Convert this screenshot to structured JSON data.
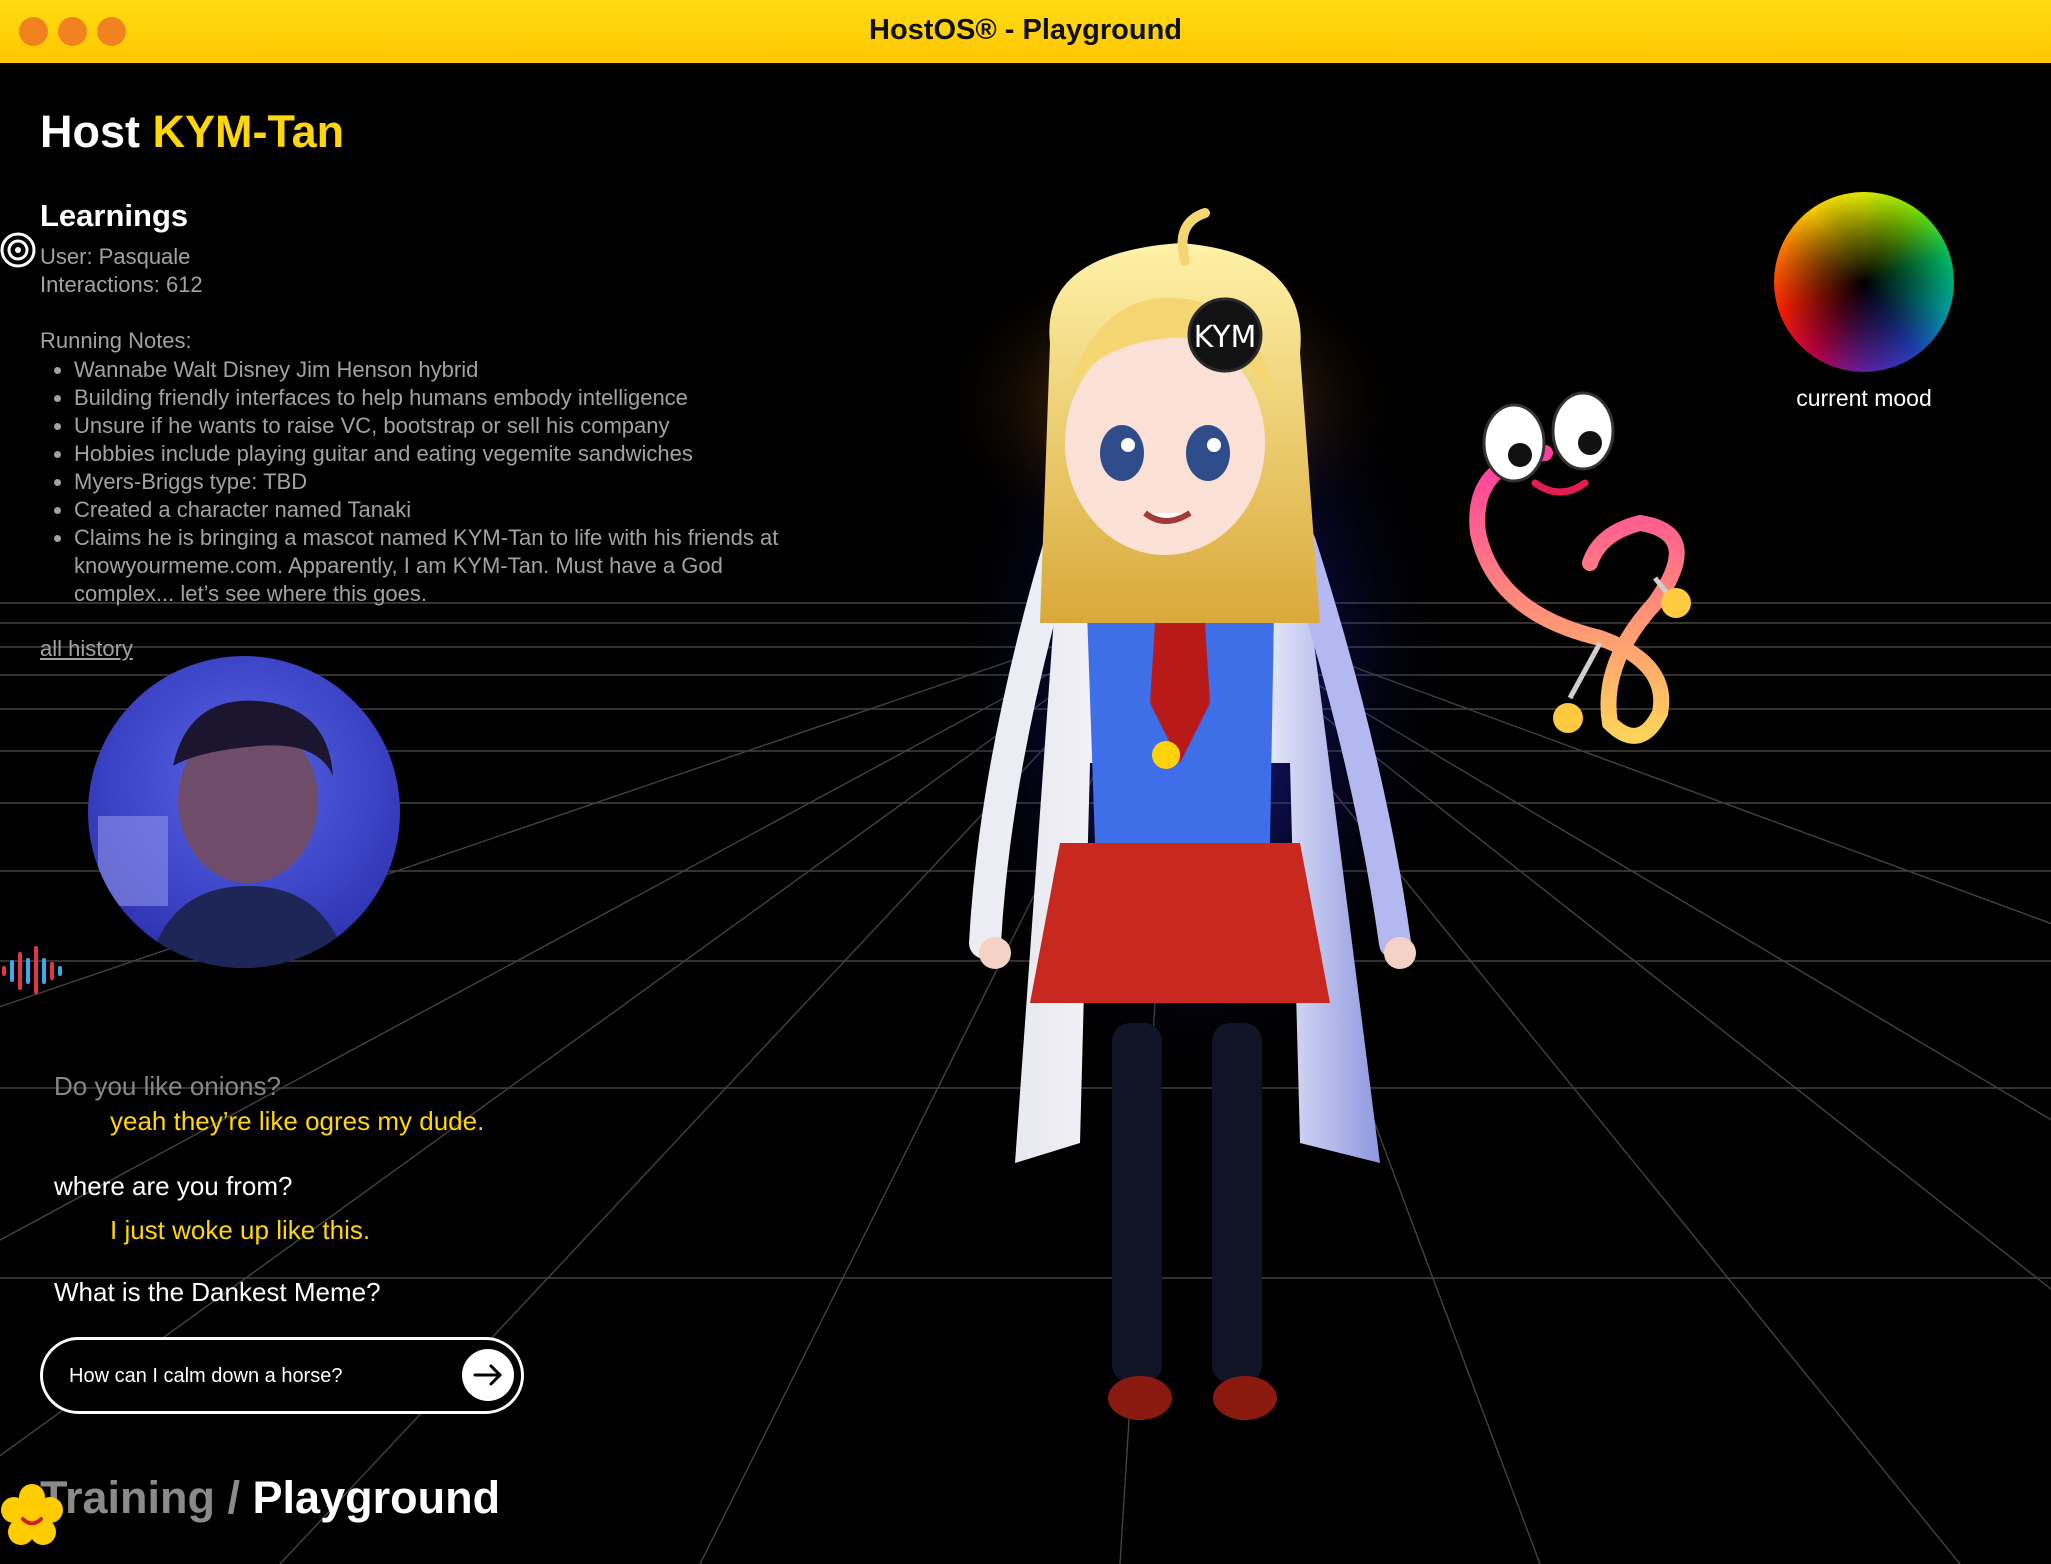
{
  "window": {
    "title": "HostOS® - Playground"
  },
  "host": {
    "prefix": "Host",
    "name": "KYM-Tan"
  },
  "learnings": {
    "heading": "Learnings",
    "user": "User: Pasquale",
    "interactions": "Interactions: 612",
    "notes_heading": "Running Notes:",
    "notes": [
      "Wannabe Walt Disney Jim Henson hybrid",
      "Building friendly interfaces to help humans embody intelligence",
      "Unsure if he wants to raise VC, bootstrap or sell his company",
      "Hobbies include playing guitar and eating vegemite sandwiches",
      "Myers-Briggs type: TBD",
      "Created a character named Tanaki",
      "Claims he is bringing a mascot named KYM-Tan to life with his friends at knowyourmeme.com. Apparently, I am KYM-Tan. Must have a God complex... let’s see where this goes."
    ],
    "history_link": "all history"
  },
  "chat": [
    {
      "question": "Do you like onions?",
      "answer": "yeah they’re like ogres my dude."
    },
    {
      "question": "where are you from?",
      "answer": "I just woke up like this."
    },
    {
      "question": "What is the Dankest Meme?",
      "answer": ""
    }
  ],
  "input": {
    "placeholder": "How can I calm down a horse?"
  },
  "mood": {
    "label": "current mood"
  },
  "avatar_badge": "KYM",
  "breadcrumb": {
    "parent": "Training",
    "separator": " / ",
    "current": "Playground"
  },
  "icons": [
    "send-arrow-icon",
    "mood-target-icon",
    "voice-wave-icon",
    "flower-logo-icon",
    "mascot-icon"
  ],
  "colors": {
    "accent": "#ffd60a",
    "titlebar": "#ffcb05",
    "traffic_light": "#f2811f",
    "background": "#000000"
  }
}
